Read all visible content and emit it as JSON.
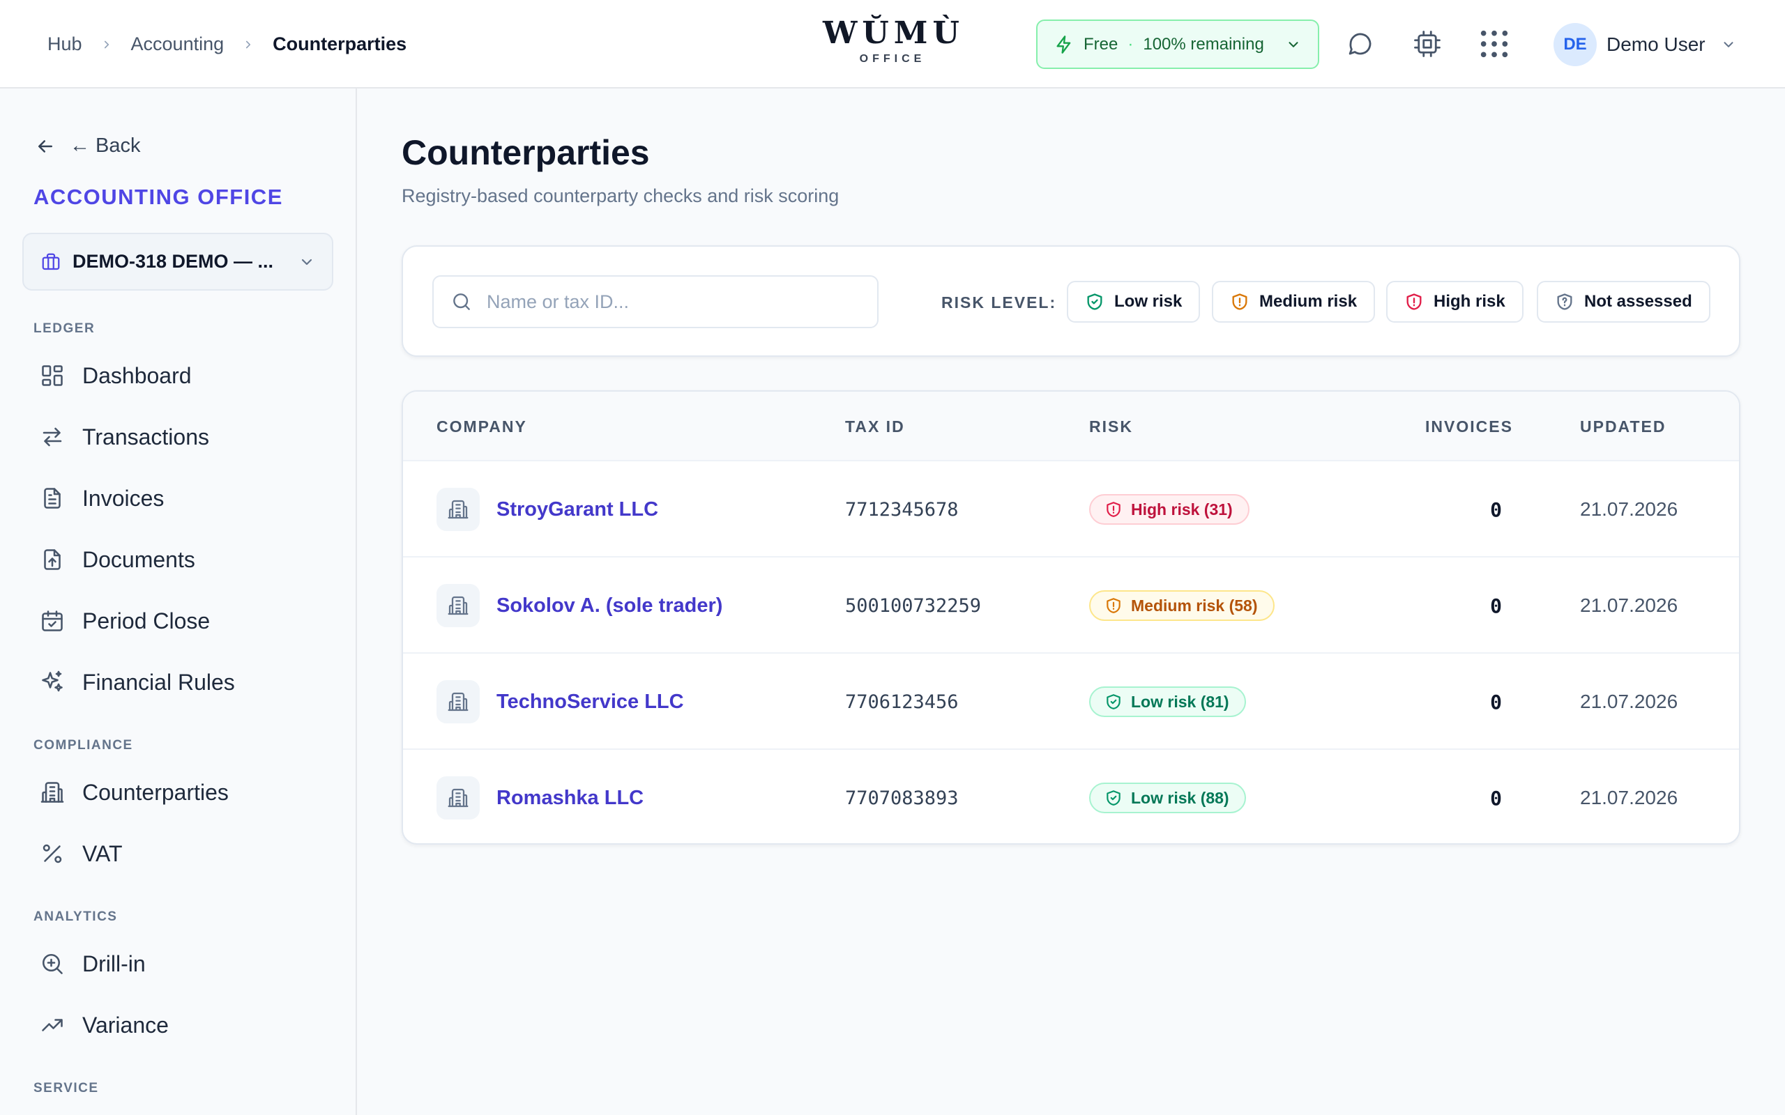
{
  "breadcrumbs": [
    {
      "label": "Hub"
    },
    {
      "label": "Accounting"
    },
    {
      "label": "Counterparties"
    }
  ],
  "logo": {
    "mark": "WŬMÙ",
    "sub": "OFFICE"
  },
  "plan": {
    "name": "Free",
    "separator": "·",
    "status": "100% remaining"
  },
  "user": {
    "initials": "DE",
    "name": "Demo User"
  },
  "sidebar": {
    "back_label": "← Back",
    "office_title": "ACCOUNTING OFFICE",
    "company": "DEMO-318 DEMO — ...",
    "sections": {
      "ledger": "LEDGER",
      "compliance": "COMPLIANCE",
      "analytics": "ANALYTICS",
      "service": "SERVICE"
    },
    "items": {
      "dashboard": "Dashboard",
      "transactions": "Transactions",
      "invoices": "Invoices",
      "documents": "Documents",
      "period_close": "Period Close",
      "financial_rules": "Financial Rules",
      "counterparties": "Counterparties",
      "vat": "VAT",
      "drill_in": "Drill-in",
      "variance": "Variance"
    }
  },
  "page": {
    "title": "Counterparties",
    "subtitle": "Registry-based counterparty checks and risk scoring"
  },
  "filters": {
    "search_placeholder": "Name or tax ID...",
    "risk_label": "RISK LEVEL:",
    "chips": {
      "low": "Low risk",
      "medium": "Medium risk",
      "high": "High risk",
      "none": "Not assessed"
    }
  },
  "table": {
    "headers": {
      "company": "COMPANY",
      "tax_id": "TAX ID",
      "risk": "RISK",
      "invoices": "INVOICES",
      "updated": "UPDATED"
    },
    "rows": [
      {
        "company": "StroyGarant LLC",
        "tax_id": "7712345678",
        "risk": "High risk (31)",
        "invoices": "0",
        "updated": "21.07.2026"
      },
      {
        "company": "Sokolov A. (sole trader)",
        "tax_id": "500100732259",
        "risk": "Medium risk (58)",
        "invoices": "0",
        "updated": "21.07.2026"
      },
      {
        "company": "TechnoService LLC",
        "tax_id": "7706123456",
        "risk": "Low risk (81)",
        "invoices": "0",
        "updated": "21.07.2026"
      },
      {
        "company": "Romashka LLC",
        "tax_id": "7707083893",
        "risk": "Low risk (88)",
        "invoices": "0",
        "updated": "21.07.2026"
      }
    ]
  },
  "colors": {
    "accent": "#4f46e5",
    "link": "#4338ca",
    "risk_high": "#be123c",
    "risk_medium": "#b45309",
    "risk_low": "#047857",
    "plan_green": "#166534"
  }
}
